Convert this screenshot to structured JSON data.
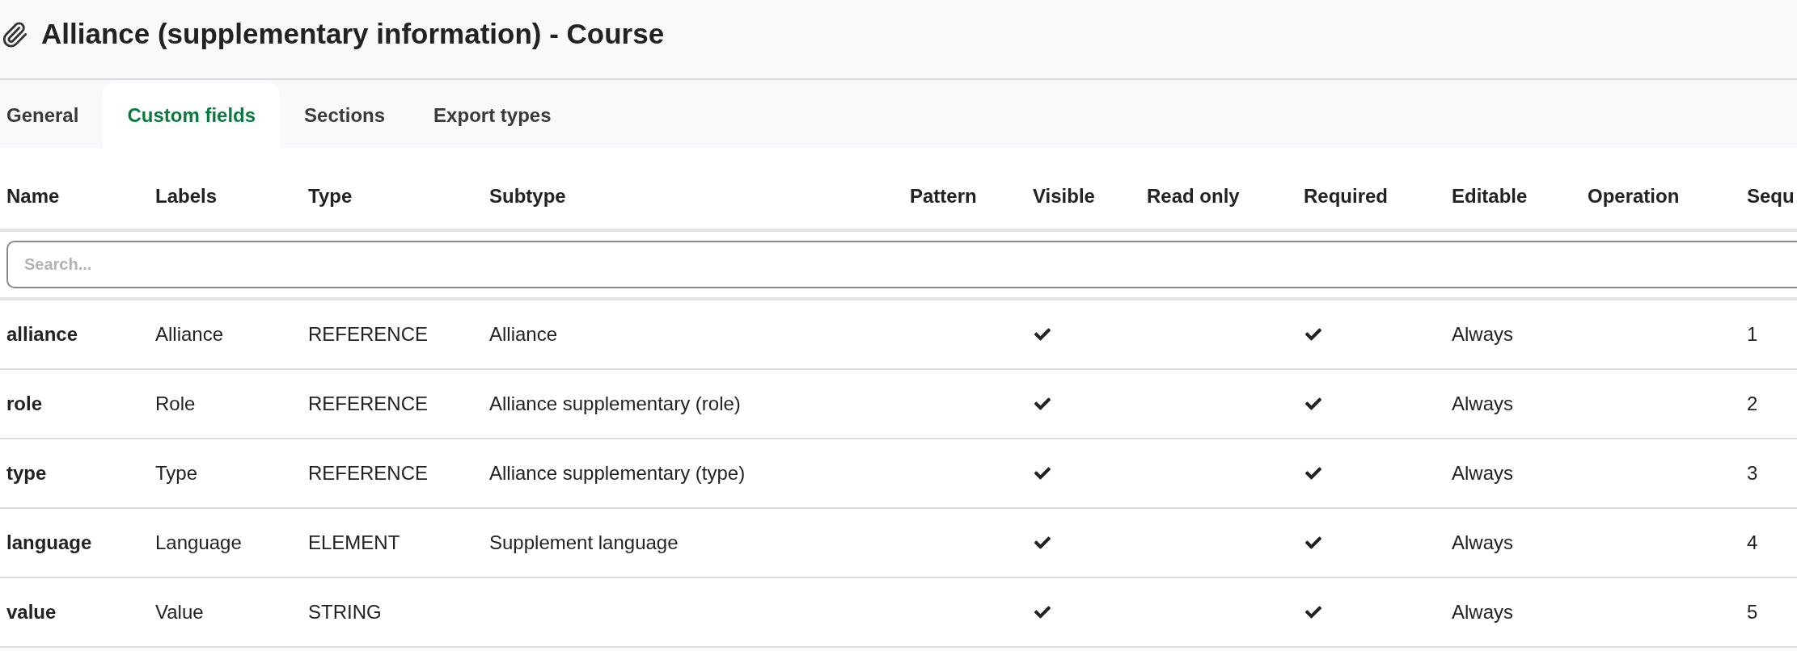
{
  "page": {
    "title": "Alliance (supplementary information) - Course"
  },
  "tabs": [
    {
      "label": "General",
      "selected": false
    },
    {
      "label": "Custom fields",
      "selected": true
    },
    {
      "label": "Sections",
      "selected": false
    },
    {
      "label": "Export types",
      "selected": false
    }
  ],
  "table": {
    "columns": [
      "Name",
      "Labels",
      "Type",
      "Subtype",
      "Pattern",
      "Visible",
      "Read only",
      "Required",
      "Editable",
      "Operation",
      "Sequ"
    ],
    "search": {
      "placeholder": "Search..."
    },
    "rows": [
      {
        "name": "alliance",
        "labels": "Alliance",
        "type": "REFERENCE",
        "subtype": "Alliance",
        "visible": true,
        "read_only": false,
        "required": true,
        "editable": "Always",
        "column_11": "1"
      },
      {
        "name": "role",
        "labels": "Role",
        "type": "REFERENCE",
        "subtype": "Alliance supplementary (role)",
        "visible": true,
        "read_only": false,
        "required": true,
        "editable": "Always",
        "column_11": "2"
      },
      {
        "name": "type",
        "labels": "Type",
        "type": "REFERENCE",
        "subtype": "Alliance supplementary (type)",
        "visible": true,
        "read_only": false,
        "required": true,
        "editable": "Always",
        "column_11": "3"
      },
      {
        "name": "language",
        "labels": "Language",
        "type": "ELEMENT",
        "subtype": "Supplement language",
        "visible": true,
        "read_only": false,
        "required": true,
        "editable": "Always",
        "column_11": "4"
      },
      {
        "name": "value",
        "labels": "Value",
        "type": "STRING",
        "visible": true,
        "read_only": false,
        "required": true,
        "editable": "Always",
        "column_11": "5"
      }
    ]
  }
}
